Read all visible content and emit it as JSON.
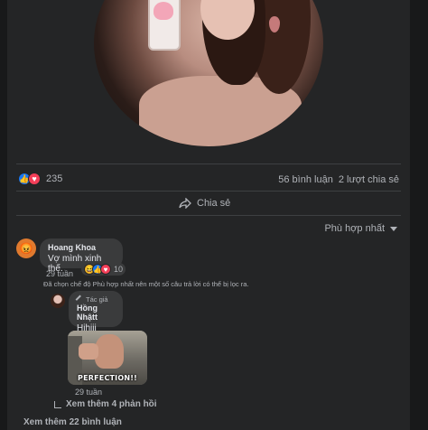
{
  "post": {
    "reaction_count": "235",
    "comments_count": "56 bình luận",
    "shares_count": "2 lượt chia sẻ",
    "share_label": "Chia sẻ"
  },
  "comments": {
    "sort_label": "Phù hợp nhất",
    "first": {
      "author": "Hoang Khoa",
      "text": "Vợ mình xinh thế.",
      "time": "29 tuần",
      "reaction_count": "10"
    },
    "filter_notice": "Đã chọn chế độ Phù hợp nhất nên một số câu trả lời có thể bị lọc ra.",
    "reply": {
      "author_tag": "Tác giả",
      "author": "Hồng Nhậtt",
      "text": "Hihiii",
      "gif_caption": "PERFECTION!!",
      "time": "29 tuần"
    },
    "view_more_replies": "Xem thêm 4 phản hồi",
    "view_more_comments": "Xem thêm 22 bình luận"
  },
  "icons": [
    "like-icon",
    "love-icon",
    "share-icon",
    "caret-down-icon",
    "haha-icon",
    "pen-icon",
    "reply-arrow-icon"
  ],
  "colors": {
    "background": "#18191a",
    "card": "#242526",
    "bubble": "#3a3b3c",
    "like": "#1877f2",
    "love": "#f33e58"
  }
}
